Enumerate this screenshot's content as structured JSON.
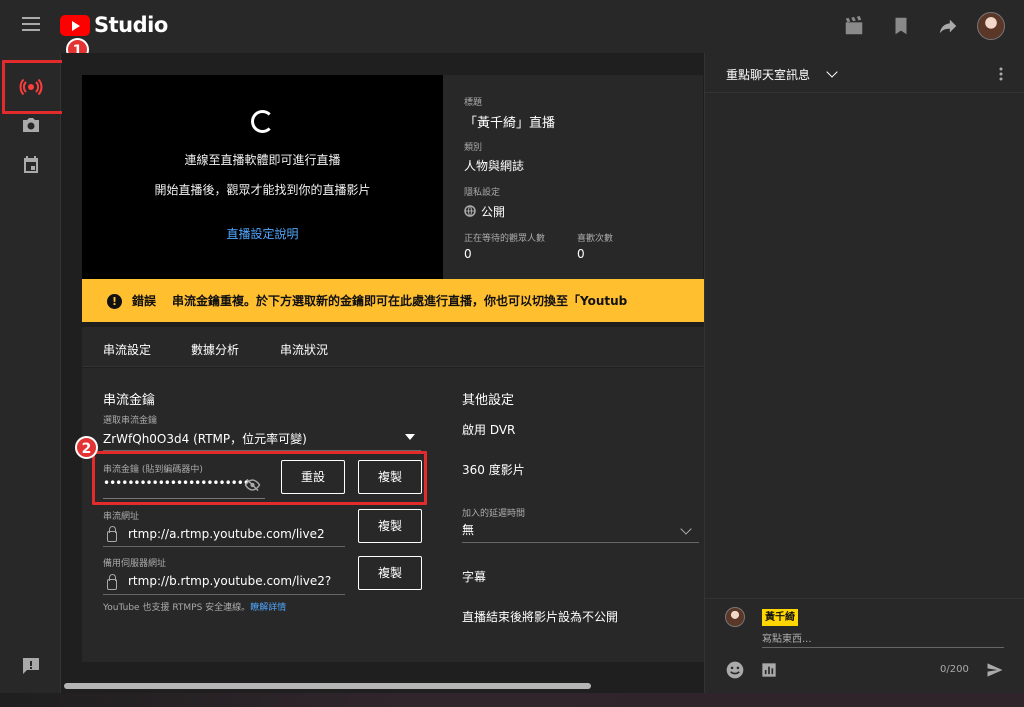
{
  "app": {
    "logo_text": "Studio"
  },
  "preview": {
    "line1": "連線至直播軟體即可進行直播",
    "line2": "開始直播後，觀眾才能找到你的直播影片",
    "link": "直播設定說明"
  },
  "info": {
    "title_label": "標題",
    "title_value": "「黃千綺」直播",
    "category_label": "類別",
    "category_value": "人物與網誌",
    "privacy_label": "隱私設定",
    "privacy_value": "公開",
    "waiting_label": "正在等待的觀眾人數",
    "waiting_value": "0",
    "likes_label": "喜歡次數",
    "likes_value": "0"
  },
  "error": {
    "icon": "!",
    "label": "錯誤",
    "message": "串流金鑰重複。於下方選取新的金鑰即可在此處進行直播，你也可以切換至「Youtub"
  },
  "tabs": [
    "串流設定",
    "數據分析",
    "串流狀況"
  ],
  "stream": {
    "section_title": "串流金鑰",
    "select_label": "選取串流金鑰",
    "select_value": "ZrWfQh0O3d4 (RTMP，位元率可變)",
    "key_label": "串流金鑰 (貼到編碼器中)",
    "key_value": "••••••••••••••••••••••••",
    "reset_button": "重設",
    "copy_button": "複製",
    "url_label": "串流網址",
    "url_value": "rtmp://a.rtmp.youtube.com/live2",
    "backup_label": "備用伺服器網址",
    "backup_value": "rtmp://b.rtmp.youtube.com/live2?",
    "rtmps_note": "YouTube 也支援 RTMPS 安全連線。",
    "learn_more": "瞭解詳情"
  },
  "other": {
    "title": "其他設定",
    "dvr": "啟用 DVR",
    "vr360": "360 度影片",
    "latency_label": "加入的延遲時間",
    "latency_value": "無",
    "captions": "字幕",
    "unlisted": "直播結束後將影片設為不公開"
  },
  "chat": {
    "title": "重點聊天室訊息",
    "user_name": "黃千綺",
    "placeholder": "寫點東西...",
    "counter": "0/200"
  },
  "annotations": {
    "badge1": "1",
    "badge2": "2"
  },
  "colors": {
    "accent": "#3ea6ff",
    "error": "#ffbf2f",
    "annotation": "#e32b2b",
    "youtube_red": "#ff0000"
  },
  "icons": [
    "menu-icon",
    "youtube-icon",
    "clapperboard-icon",
    "bookmark-icon",
    "share-icon",
    "live-icon",
    "camera-icon",
    "calendar-icon",
    "feedback-icon",
    "lock-icon",
    "hide-icon",
    "chevron-down-icon",
    "more-vertical-icon",
    "emoji-icon",
    "chart-icon",
    "send-icon"
  ]
}
